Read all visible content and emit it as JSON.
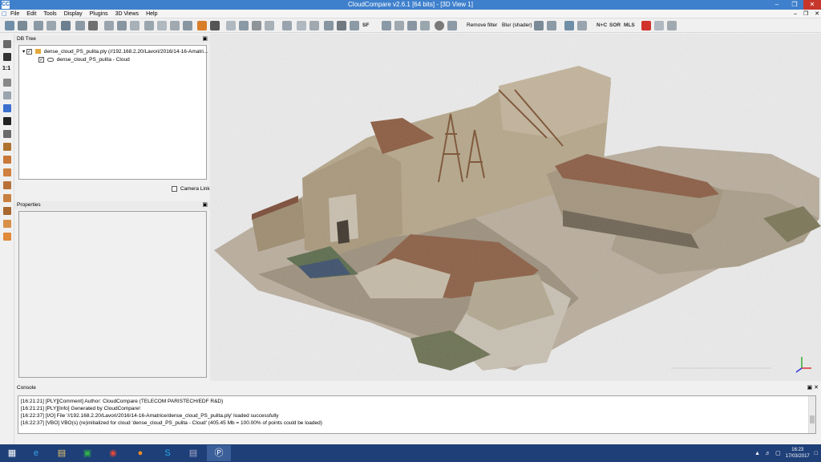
{
  "window": {
    "title": "CloudCompare v2.6.1 [64 bits] - [3D View 1]",
    "app_icon_glyph": "CC"
  },
  "menubar": {
    "items": [
      "File",
      "Edit",
      "Tools",
      "Display",
      "Plugins",
      "3D Views",
      "Help"
    ]
  },
  "toolbar": {
    "remove_filter_label": "Remove filter",
    "blur_label": "Blur (shader)",
    "sf_label": "SF",
    "nc_label": "N+C",
    "sor_label": "SOR",
    "mls_label": "MLS"
  },
  "dbtree": {
    "header": "DB Tree",
    "file_entry": "dense_cloud_PS_pulita.ply (//192.168.2.20/Lavori/2016/14-16-Amatri...",
    "cloud_entry": "dense_cloud_PS_pulita - Cloud",
    "camera_link_label": "Camera Link"
  },
  "properties": {
    "header": "Properties"
  },
  "left_tools": {
    "ratio_label": "1:1"
  },
  "console": {
    "header": "Console",
    "lines": [
      "[16:21:21] [PLY][Comment] Author: CloudCompare (TELECOM PARISTECH/EDF R&D)",
      "[16:21:21] [PLY][Info] Generated by CloudCompare!",
      "[16:22:37] [I/O] File '//192.168.2.20/Lavori/2016/14-16-Amatrice/dense_cloud_PS_pulita.ply' loaded successfully",
      "[16:22:37] [VBO] VBO(s) (re)initialized for cloud 'dense_cloud_PS_pulita - Cloud' (405.45 Mb = 100.00% of points could be loaded)"
    ]
  },
  "taskbar": {
    "time": "16:23",
    "date": "17/03/2017"
  },
  "colors": {
    "titlebar": "#3f80cc",
    "taskbar": "#1e3f78",
    "close_button": "#c7362b"
  }
}
